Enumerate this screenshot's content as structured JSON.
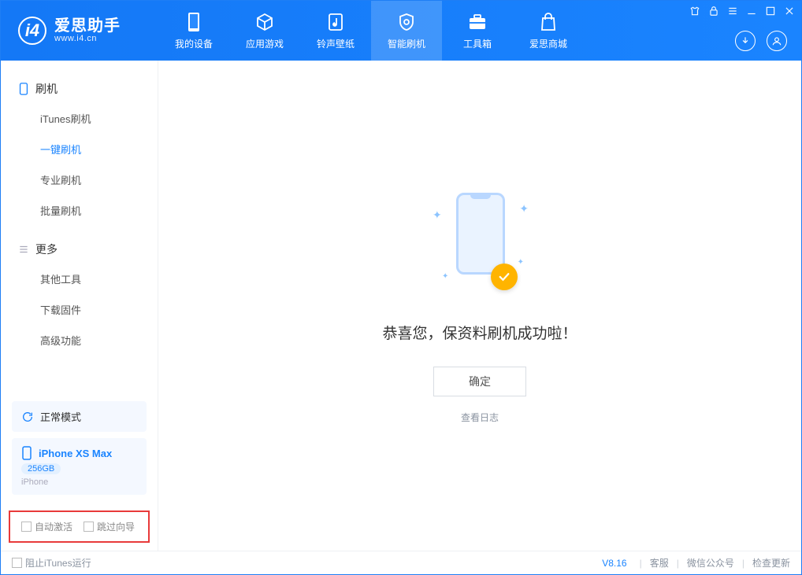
{
  "app": {
    "name": "爱思助手",
    "url": "www.i4.cn"
  },
  "nav": {
    "items": [
      {
        "label": "我的设备"
      },
      {
        "label": "应用游戏"
      },
      {
        "label": "铃声壁纸"
      },
      {
        "label": "智能刷机"
      },
      {
        "label": "工具箱"
      },
      {
        "label": "爱思商城"
      }
    ]
  },
  "sidebar": {
    "group1_title": "刷机",
    "group1_items": [
      "iTunes刷机",
      "一键刷机",
      "专业刷机",
      "批量刷机"
    ],
    "group2_title": "更多",
    "group2_items": [
      "其他工具",
      "下载固件",
      "高级功能"
    ],
    "mode": "正常模式",
    "device": {
      "name": "iPhone XS Max",
      "capacity": "256GB",
      "type": "iPhone"
    },
    "checkbox1": "自动激活",
    "checkbox2": "跳过向导"
  },
  "main": {
    "success_text": "恭喜您，保资料刷机成功啦！",
    "ok_label": "确定",
    "log_link": "查看日志"
  },
  "footer": {
    "block_itunes": "阻止iTunes运行",
    "version": "V8.16",
    "links": [
      "客服",
      "微信公众号",
      "检查更新"
    ]
  }
}
